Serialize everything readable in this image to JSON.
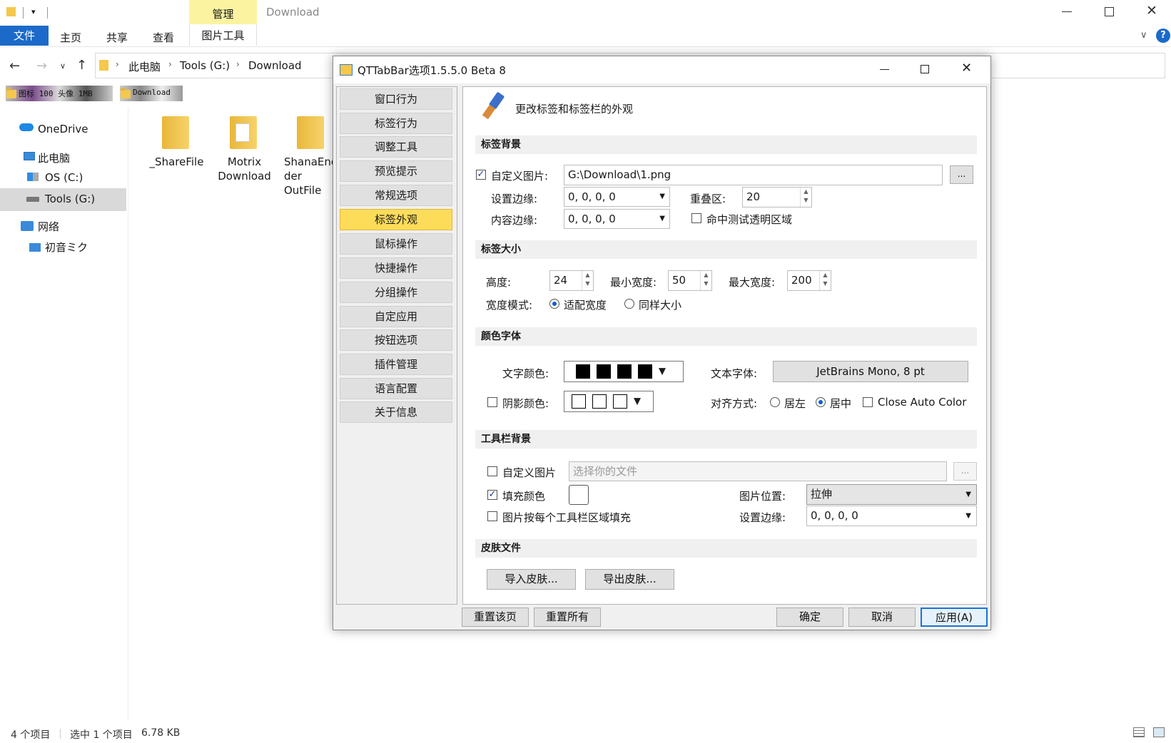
{
  "explorer": {
    "title": "Download",
    "context_tab": "管理",
    "ribbon_tabs": [
      "文件",
      "主页",
      "共享",
      "查看",
      "图片工具"
    ],
    "path": [
      "此电脑",
      "Tools (G:)",
      "Download"
    ],
    "thumb_labels": [
      "图标 100 头像 1MB",
      "Download"
    ],
    "sidebar": {
      "onedrive": "OneDrive",
      "thispc": "此电脑",
      "osc": "OS (C:)",
      "toolsg": "Tools (G:)",
      "network": "网络",
      "host": "初音ミク"
    },
    "files": [
      {
        "name": "_ShareFile"
      },
      {
        "name": "Motrix\nDownload"
      },
      {
        "name": "ShanaEnc\nder\nOutFile"
      }
    ],
    "status": {
      "count": "4 个项目",
      "selected": "选中 1 个项目",
      "size": "6.78 KB"
    }
  },
  "dialog": {
    "title": "QTTabBar选项1.5.5.0 Beta 8",
    "nav": [
      "窗口行为",
      "标签行为",
      "调整工具",
      "预览提示",
      "常规选项",
      "标签外观",
      "鼠标操作",
      "快捷操作",
      "分组操作",
      "自定应用",
      "按钮选项",
      "插件管理",
      "语言配置",
      "关于信息"
    ],
    "heading": "更改标签和标签栏的外观",
    "tab_bg": {
      "section": "标签背景",
      "custom_image_label": "自定义图片:",
      "custom_image_value": "G:\\Download\\1.png",
      "browse": "...",
      "margin_label": "设置边缘:",
      "margin_value": "0, 0, 0, 0",
      "overlap_label": "重叠区:",
      "overlap_value": "20",
      "content_margin_label": "内容边缘:",
      "content_margin_value": "0, 0, 0, 0",
      "hit_test_label": "命中测试透明区域"
    },
    "tab_size": {
      "section": "标签大小",
      "height_label": "高度:",
      "height_value": "24",
      "min_width_label": "最小宽度:",
      "min_width_value": "50",
      "max_width_label": "最大宽度:",
      "max_width_value": "200",
      "width_mode_label": "宽度模式:",
      "fit_width": "适配宽度",
      "same_size": "同样大小"
    },
    "color_font": {
      "section": "颜色字体",
      "text_color_label": "文字颜色:",
      "shadow_color_label": "阴影颜色:",
      "font_label": "文本字体:",
      "font_value": "JetBrains Mono, 8 pt",
      "align_label": "对齐方式:",
      "align_left": "居左",
      "align_center": "居中",
      "close_auto_color": "Close Auto Color"
    },
    "toolbar_bg": {
      "section": "工具栏背景",
      "custom_image_label": "自定义图片",
      "custom_image_placeholder": "选择你的文件",
      "browse": "...",
      "fill_color_label": "填充颜色",
      "image_pos_label": "图片位置:",
      "image_pos_value": "拉伸",
      "per_area_label": "图片按每个工具栏区域填充",
      "margin_label": "设置边缘:",
      "margin_value": "0, 0, 0, 0"
    },
    "skin": {
      "section": "皮肤文件",
      "import": "导入皮肤...",
      "export": "导出皮肤..."
    },
    "footer": {
      "reset_page": "重置该页",
      "reset_all": "重置所有",
      "ok": "确定",
      "cancel": "取消",
      "apply": "应用(A)"
    }
  }
}
